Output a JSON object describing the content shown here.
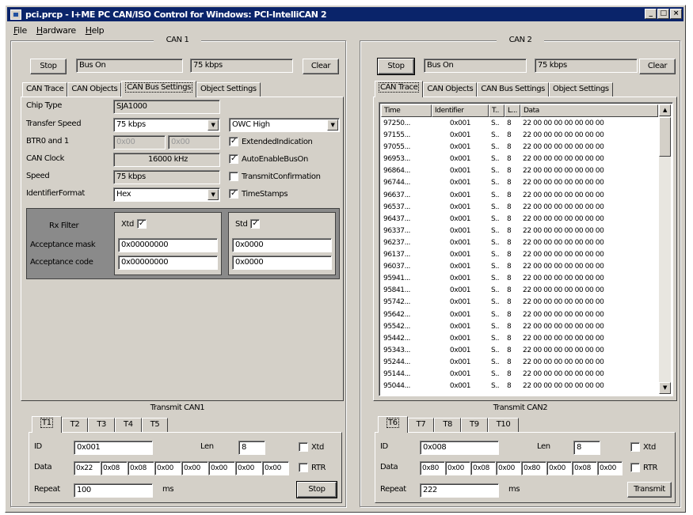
{
  "window": {
    "title": "pci.prcp - I+ME PC CAN/ISO Control for Windows: PCI-IntelliCAN 2",
    "buttons": [
      "_",
      "□",
      "×"
    ]
  },
  "menu": [
    "File",
    "Hardware",
    "Help"
  ],
  "can1": {
    "title": "CAN 1",
    "stop_label": "Stop",
    "status": "Bus On",
    "speed": "75 kbps",
    "clear_label": "Clear",
    "tabs": [
      "CAN Trace",
      "CAN Objects",
      "CAN Bus Settings",
      "Object Settings"
    ],
    "settings": {
      "chip_type_label": "Chip Type",
      "chip_type": "SJA1000",
      "transfer_speed_label": "Transfer Speed",
      "transfer_speed": "75 kbps",
      "output": "OWC High",
      "btr_label": "BTR0 and 1",
      "btr0": "0x00",
      "btr1": "0x00",
      "clock_label": "CAN Clock",
      "clock": "16000 kHz",
      "speed_label": "Speed",
      "speed": "75 kbps",
      "idformat_label": "IdentifierFormat",
      "idformat": "Hex",
      "checks": [
        {
          "label": "ExtendedIndication",
          "checked": true
        },
        {
          "label": "AutoEnableBusOn",
          "checked": true
        },
        {
          "label": "TransmitConfirmation",
          "checked": false
        },
        {
          "label": "TimeStamps",
          "checked": true
        }
      ],
      "filter": {
        "title": "Rx Filter",
        "xtd_label": "Xtd",
        "std_label": "Std",
        "mask_label": "Acceptance mask",
        "code_label": "Acceptance code",
        "xtd_mask": "0x00000000",
        "xtd_code": "0x00000000",
        "std_mask": "0x0000",
        "std_code": "0x0000"
      }
    },
    "transmit": {
      "title": "Transmit CAN1",
      "tabs": [
        "T1",
        "T2",
        "T3",
        "T4",
        "T5"
      ],
      "id_label": "ID",
      "id": "0x001",
      "len_label": "Len",
      "len": "8",
      "xtd_label": "Xtd",
      "data_label": "Data",
      "data": [
        "0x22",
        "0x08",
        "0x08",
        "0x00",
        "0x00",
        "0x00",
        "0x00",
        "0x00"
      ],
      "rtr_label": "RTR",
      "repeat_label": "Repeat",
      "repeat": "100",
      "ms": "ms",
      "action": "Stop"
    }
  },
  "can2": {
    "title": "CAN 2",
    "stop_label": "Stop",
    "status": "Bus On",
    "speed": "75 kbps",
    "clear_label": "Clear",
    "tabs": [
      "CAN Trace",
      "CAN Objects",
      "CAN Bus Settings",
      "Object Settings"
    ],
    "trace": {
      "columns": [
        "Time",
        "Identifier",
        "T..",
        "L...",
        "Data"
      ],
      "rows": [
        [
          "97250...",
          "0x001",
          "S..",
          "8",
          "22 00 00 00 00 00 00 00"
        ],
        [
          "97155...",
          "0x001",
          "S..",
          "8",
          "22 00 00 00 00 00 00 00"
        ],
        [
          "97055...",
          "0x001",
          "S..",
          "8",
          "22 00 00 00 00 00 00 00"
        ],
        [
          "96953...",
          "0x001",
          "S..",
          "8",
          "22 00 00 00 00 00 00 00"
        ],
        [
          "96864...",
          "0x001",
          "S..",
          "8",
          "22 00 00 00 00 00 00 00"
        ],
        [
          "96744...",
          "0x001",
          "S..",
          "8",
          "22 00 00 00 00 00 00 00"
        ],
        [
          "96637...",
          "0x001",
          "S..",
          "8",
          "22 00 00 00 00 00 00 00"
        ],
        [
          "96537...",
          "0x001",
          "S..",
          "8",
          "22 00 00 00 00 00 00 00"
        ],
        [
          "96437...",
          "0x001",
          "S..",
          "8",
          "22 00 00 00 00 00 00 00"
        ],
        [
          "96337...",
          "0x001",
          "S..",
          "8",
          "22 00 00 00 00 00 00 00"
        ],
        [
          "96237...",
          "0x001",
          "S..",
          "8",
          "22 00 00 00 00 00 00 00"
        ],
        [
          "96137...",
          "0x001",
          "S..",
          "8",
          "22 00 00 00 00 00 00 00"
        ],
        [
          "96037...",
          "0x001",
          "S..",
          "8",
          "22 00 00 00 00 00 00 00"
        ],
        [
          "95941...",
          "0x001",
          "S..",
          "8",
          "22 00 00 00 00 00 00 00"
        ],
        [
          "95841...",
          "0x001",
          "S..",
          "8",
          "22 00 00 00 00 00 00 00"
        ],
        [
          "95742...",
          "0x001",
          "S..",
          "8",
          "22 00 00 00 00 00 00 00"
        ],
        [
          "95642...",
          "0x001",
          "S..",
          "8",
          "22 00 00 00 00 00 00 00"
        ],
        [
          "95542...",
          "0x001",
          "S..",
          "8",
          "22 00 00 00 00 00 00 00"
        ],
        [
          "95442...",
          "0x001",
          "S..",
          "8",
          "22 00 00 00 00 00 00 00"
        ],
        [
          "95343...",
          "0x001",
          "S..",
          "8",
          "22 00 00 00 00 00 00 00"
        ],
        [
          "95244...",
          "0x001",
          "S..",
          "8",
          "22 00 00 00 00 00 00 00"
        ],
        [
          "95144...",
          "0x001",
          "S..",
          "8",
          "22 00 00 00 00 00 00 00"
        ],
        [
          "95044...",
          "0x001",
          "S..",
          "8",
          "22 00 00 00 00 00 00 00"
        ]
      ]
    },
    "transmit": {
      "title": "Transmit CAN2",
      "tabs": [
        "T6",
        "T7",
        "T8",
        "T9",
        "T10"
      ],
      "id_label": "ID",
      "id": "0x008",
      "len_label": "Len",
      "len": "8",
      "xtd_label": "Xtd",
      "data_label": "Data",
      "data": [
        "0x80",
        "0x00",
        "0x08",
        "0x00",
        "0x80",
        "0x00",
        "0x08",
        "0x00"
      ],
      "rtr_label": "RTR",
      "repeat_label": "Repeat",
      "repeat": "222",
      "ms": "ms",
      "action": "Transmit"
    }
  }
}
